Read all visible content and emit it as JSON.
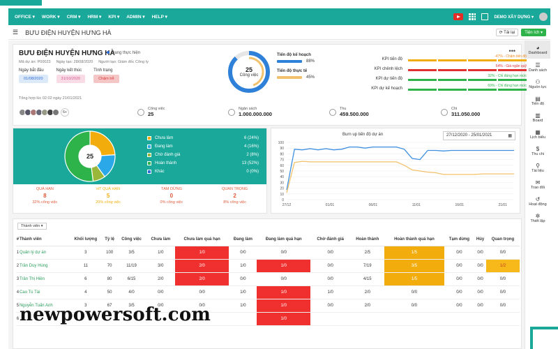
{
  "topbar": {
    "menu": [
      "OFFICE ▾",
      "WORK ▾",
      "CRM ▾",
      "HRM ▾",
      "KPI ▾",
      "ADMIN ▾",
      "HELP ▾"
    ],
    "user": "DEMO XÂY DỰNG ▾"
  },
  "subbar": {
    "title": "BƯU ĐIỆN HUYỆN HƯNG HÀ",
    "btn_refresh": "⟳ Tải lại",
    "btn_utils": "Tiện ích ▾"
  },
  "sidebar": [
    {
      "icon": "dashboard-icon",
      "glyph": "◕",
      "label": "Dashboard"
    },
    {
      "icon": "list-icon",
      "glyph": "☰",
      "label": "Danh sách"
    },
    {
      "icon": "resource-icon",
      "glyph": "⚇",
      "label": "Nguồn lực"
    },
    {
      "icon": "progress-icon",
      "glyph": "▤",
      "label": "Tiến độ"
    },
    {
      "icon": "board-icon",
      "glyph": "▥",
      "label": "Board"
    },
    {
      "icon": "calendar-icon",
      "glyph": "▦",
      "label": "Lịch biểu"
    },
    {
      "icon": "money-icon",
      "glyph": "$",
      "label": "Thu chi"
    },
    {
      "icon": "attachment-icon",
      "glyph": "⚲",
      "label": "Tài liệu"
    },
    {
      "icon": "chat-icon",
      "glyph": "✉",
      "label": "Trao đổi"
    },
    {
      "icon": "history-icon",
      "glyph": "↺",
      "label": "Hoạt động"
    },
    {
      "icon": "settings-icon",
      "glyph": "✲",
      "label": "Thiết lập"
    }
  ],
  "project": {
    "title": "BƯU ĐIỆN HUYỆN HƯNG HÀ",
    "status": "Đang thực hiện",
    "code": "Mã dự án: P00023",
    "created": "Ngày tạo: 28/08/2020",
    "creator": "Người tạo: Giám đốc Công ty",
    "start_label": "Ngày bắt đầu",
    "start": "01/08/2020",
    "end_label": "Ngày kết thúc",
    "end": "31/10/2020",
    "state_label": "Tình trạng",
    "state": "Chậm trễ",
    "summary_time": "Tổng hợp lúc 02:02 ngày 21/01/2021",
    "more": "•••"
  },
  "donut": {
    "value": "25",
    "label": "Công việc",
    "percent": 0.88
  },
  "plan": {
    "plan_label": "Tiến độ kế hoạch",
    "plan_pct": "88%",
    "actual_label": "Tiến độ thực tế",
    "actual_pct": "45%"
  },
  "kpis": [
    {
      "name": "KPI tiến độ",
      "note": "-47% - Chậm tiến độ",
      "note_color": "#f08a24",
      "colors": [
        "#f2ad0d",
        "#f2ad0d",
        "#f2ad0d",
        "#f2ad0d"
      ]
    },
    {
      "name": "KPI chênh lệch",
      "note": "54% - Giá ngân quỹ",
      "note_color": "#e03030",
      "colors": [
        "#e03030",
        "#e03030",
        "#e03030",
        "#e03030"
      ]
    },
    {
      "name": "KPI dự tiến độ",
      "note": "32% - Chỉ đúng hạn mức",
      "note_color": "#2db34a",
      "colors": [
        "#2db34a",
        "#2db34a",
        "#2db34a",
        "#2db34a"
      ]
    },
    {
      "name": "KPI dự kế hoạch",
      "note": "69% - Chỉ đúng hạn mức",
      "note_color": "#2db34a",
      "colors": [
        "#2db34a",
        "#2db34a",
        "#2db34a",
        "#2db34a"
      ]
    }
  ],
  "stats": [
    {
      "label": "Công việc",
      "value": "25"
    },
    {
      "label": "Ngân sách",
      "value": "1.000.000.000"
    },
    {
      "label": "Thu",
      "value": "459.500.000"
    },
    {
      "label": "Chi",
      "value": "311.050.000"
    }
  ],
  "avatars_more": "6+",
  "pie": {
    "center": "25",
    "legend": [
      {
        "label": "Chưa làm",
        "value": "6 (24%)",
        "color": "#f2ad0d"
      },
      {
        "label": "Đang làm",
        "value": "4 (16%)",
        "color": "#2aa8e8"
      },
      {
        "label": "Chờ đánh giá",
        "value": "2 (8%)",
        "color": "#9bb73a"
      },
      {
        "label": "Hoàn thành",
        "value": "13 (52%)",
        "color": "#2db34a"
      },
      {
        "label": "Khác",
        "value": "0 (0%)",
        "color": "#2f6bd8"
      }
    ],
    "stats": [
      {
        "title": "QUÁ HẠN",
        "num": "8",
        "sub": "32% công việc",
        "color": "#e05a3a"
      },
      {
        "title": "HT QUÁ HẠN",
        "num": "5",
        "sub": "20% công việc",
        "color": "#f2ad0d"
      },
      {
        "title": "TẠM DỪNG",
        "num": "0",
        "sub": "0% công việc",
        "color": "#e05a3a"
      },
      {
        "title": "QUAN TRỌNG",
        "num": "2",
        "sub": "8% công việc",
        "color": "#e05a3a"
      }
    ]
  },
  "chart_data": {
    "type": "line",
    "title": "Burn up tiến độ dự án",
    "date_range": "27/12/2020 - 25/01/2021",
    "x": [
      "27/12",
      "01/01",
      "06/01",
      "11/01",
      "16/01",
      "21/01"
    ],
    "ylim": [
      0,
      100
    ],
    "yticks": [
      0,
      10,
      20,
      30,
      40,
      50,
      60,
      70,
      80,
      90,
      100
    ],
    "series": [
      {
        "color": "#3b8ee0",
        "values": [
          17,
          88,
          87,
          89,
          87,
          89,
          87,
          88,
          92,
          92,
          90,
          92,
          92,
          92,
          92,
          88,
          72,
          70,
          86,
          86,
          85,
          86,
          86,
          86,
          86,
          86,
          86,
          86,
          86,
          86
        ]
      },
      {
        "color": "#f2c16b",
        "values": [
          12,
          65,
          67,
          66,
          66,
          66,
          66,
          66,
          66,
          66,
          66,
          66,
          66,
          66,
          66,
          60,
          52,
          50,
          48,
          47,
          44,
          44,
          44,
          44,
          44,
          45,
          45,
          45,
          45,
          45
        ]
      }
    ]
  },
  "table": {
    "button": "Thành viên ▾",
    "headers": [
      "#",
      "Thành viên",
      "Khối lượng",
      "Tỷ lệ",
      "Công việc",
      "Chưa làm",
      "Chưa làm quá hạn",
      "Đang làm",
      "Đang làm quá hạn",
      "Chờ đánh giá",
      "Hoàn thành",
      "Hoàn thành quá hạn",
      "Tạm dừng",
      "Hủy",
      "Quan trọng"
    ],
    "rows": [
      [
        "1",
        "Quản lý dự án",
        "3",
        "100",
        "3/5",
        "1/0",
        "1/0",
        "0/0",
        "0/0",
        "0/0",
        "2/5",
        "1/5",
        "0/0",
        "0/0",
        "0/0"
      ],
      [
        "2",
        "Trần Duy Hùng",
        "11",
        "70",
        "11/19",
        "3/0",
        "2/0",
        "1/0",
        "1/0",
        "0/0",
        "7/19",
        "3/5",
        "0/0",
        "0/0",
        "1/2"
      ],
      [
        "3",
        "Trần Thị Hiền",
        "6",
        "80",
        "6/15",
        "2/0",
        "2/0",
        "0/0",
        "0/0",
        "0/0",
        "4/15",
        "1/5",
        "0/0",
        "0/0",
        "0/0"
      ],
      [
        "4",
        "Cao Tú Tài",
        "4",
        "50",
        "4/0",
        "0/0",
        "0/0",
        "1/0",
        "1/0",
        "1/0",
        "2/0",
        "0/0",
        "0/0",
        "0/0",
        "0/0"
      ],
      [
        "5",
        "Nguyễn Tuấn Anh",
        "3",
        "67",
        "3/5",
        "0/0",
        "0/0",
        "1/0",
        "1/0",
        "0/0",
        "2/0",
        "0/0",
        "0/0",
        "0/0",
        "0/0"
      ],
      [
        "6",
        "",
        "",
        "",
        "",
        "",
        "",
        "",
        "1/0",
        "",
        "",
        "",
        "",
        "",
        ""
      ]
    ],
    "highlights": {
      "red": [
        [
          0,
          6
        ],
        [
          1,
          6
        ],
        [
          2,
          6
        ],
        [
          1,
          8
        ],
        [
          3,
          8
        ],
        [
          4,
          8
        ],
        [
          5,
          8
        ]
      ],
      "yellow": [
        [
          0,
          11
        ],
        [
          1,
          11
        ],
        [
          2,
          11
        ]
      ],
      "yellow2": [
        [
          1,
          14
        ]
      ]
    }
  },
  "watermark": "newpowersoft.com"
}
